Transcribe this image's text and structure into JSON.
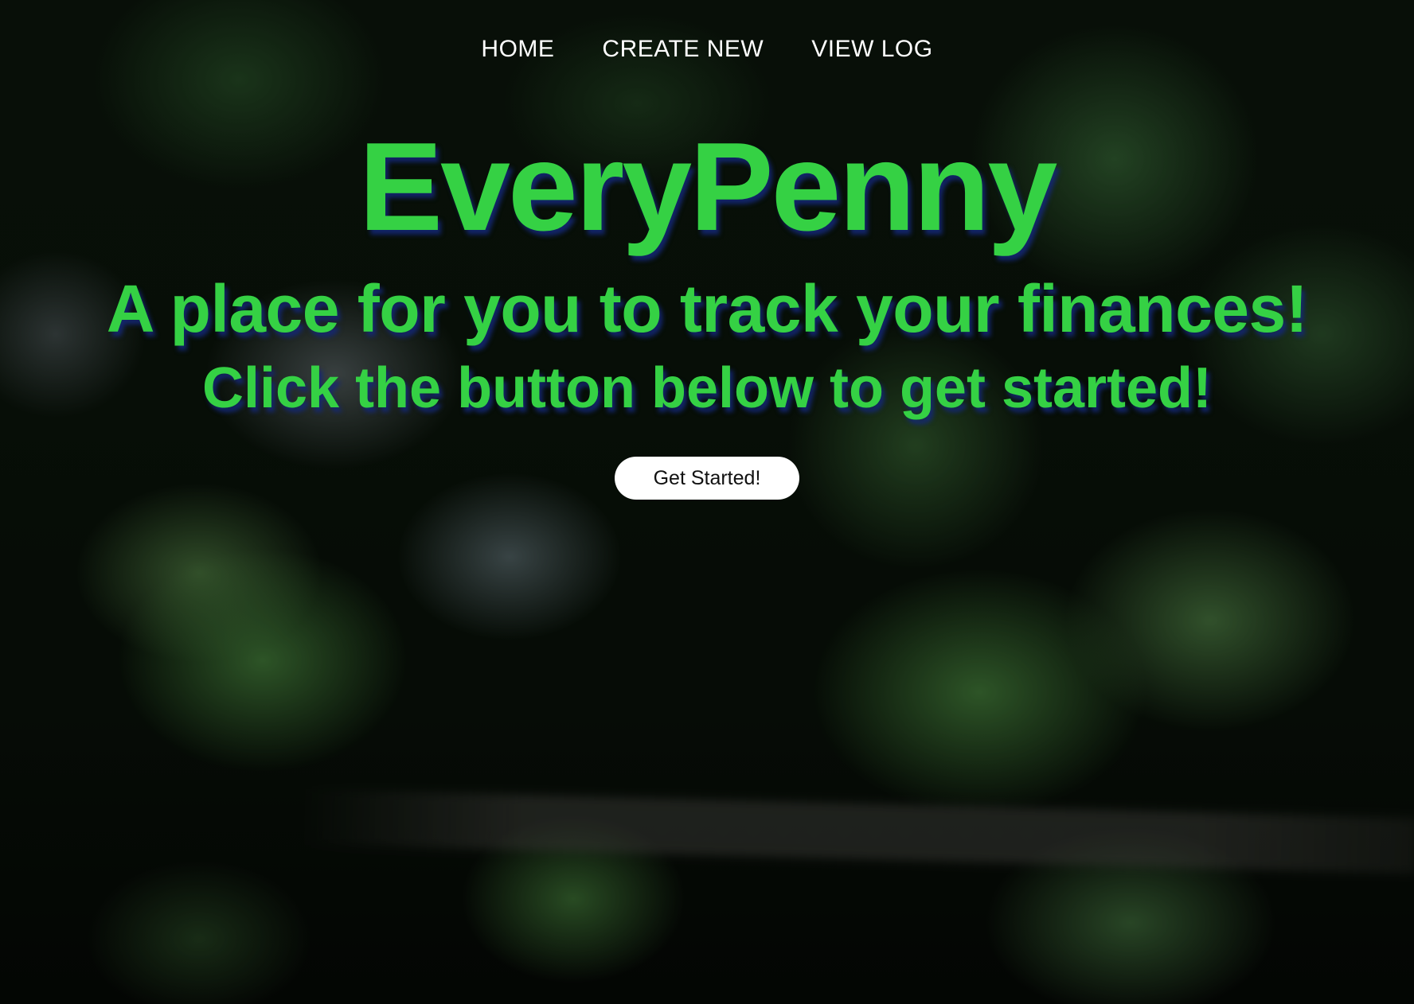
{
  "nav": {
    "items": [
      {
        "label": "HOME"
      },
      {
        "label": "CREATE NEW"
      },
      {
        "label": "VIEW LOG"
      }
    ]
  },
  "hero": {
    "title": "EveryPenny",
    "subtitle": "A place for you to track your finances!",
    "instruction": "Click the button below to get started!",
    "cta_label": "Get Started!"
  },
  "colors": {
    "hero_text": "#35d144",
    "nav_text": "#ffffff",
    "cta_background": "#ffffff",
    "cta_text": "#111111"
  }
}
